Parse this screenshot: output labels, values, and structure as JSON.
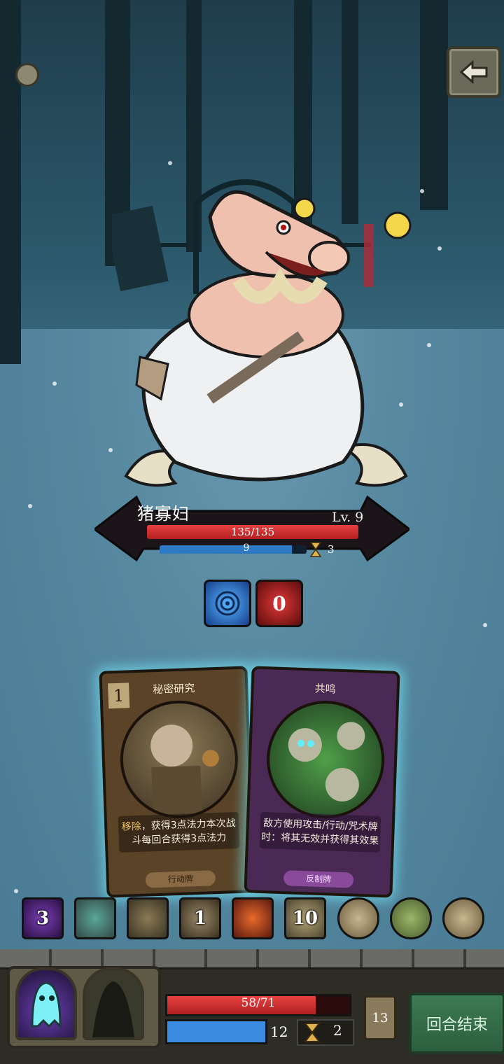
{
  "boss": {
    "name": "猪寡妇",
    "level": "Lv. 9",
    "hp_text": "135/135",
    "hp_fraction": 1.0,
    "mana": "9",
    "mana_fraction": 0.9,
    "turns": "3"
  },
  "boss_status": [
    {
      "icon": "shield-face-icon",
      "value": ""
    },
    {
      "icon": "rage-icon",
      "value": "0"
    }
  ],
  "cards": [
    {
      "cost": "1",
      "title": "秘密研究",
      "desc_highlight": "移除",
      "desc_rest": "，获得3点法力本次战斗每回合获得3点法力",
      "type": "行动牌"
    },
    {
      "cost": "",
      "title": "共鸣",
      "desc_highlight": "",
      "desc_rest": "敌方使用攻击/行动/咒术牌时：将其无效并获得其效果",
      "type": "反制牌"
    }
  ],
  "deck": [
    {
      "icon": "scythe-icon",
      "count": "3"
    },
    {
      "icon": "zombie-icon",
      "count": ""
    },
    {
      "icon": "gravedigger-icon",
      "count": ""
    },
    {
      "icon": "old-man-icon",
      "count": "1"
    },
    {
      "icon": "skull-orb-icon",
      "count": ""
    },
    {
      "icon": "coin-icon",
      "count": "10"
    },
    {
      "icon": "clock-icon",
      "count": ""
    },
    {
      "icon": "lantern-icon",
      "count": ""
    },
    {
      "icon": "wind-icon",
      "count": ""
    }
  ],
  "player": {
    "hp_text": "58/71",
    "hp_fraction": 0.817,
    "mana": "12",
    "mana_fraction": 1.0,
    "turns": "2",
    "draw_pile": "13"
  },
  "buttons": {
    "end_turn": "回合结束"
  },
  "colors": {
    "hp": "#d83030",
    "mana": "#2e79c3",
    "card_glow": "#78f0ff",
    "end_turn": "#3c7a52"
  }
}
